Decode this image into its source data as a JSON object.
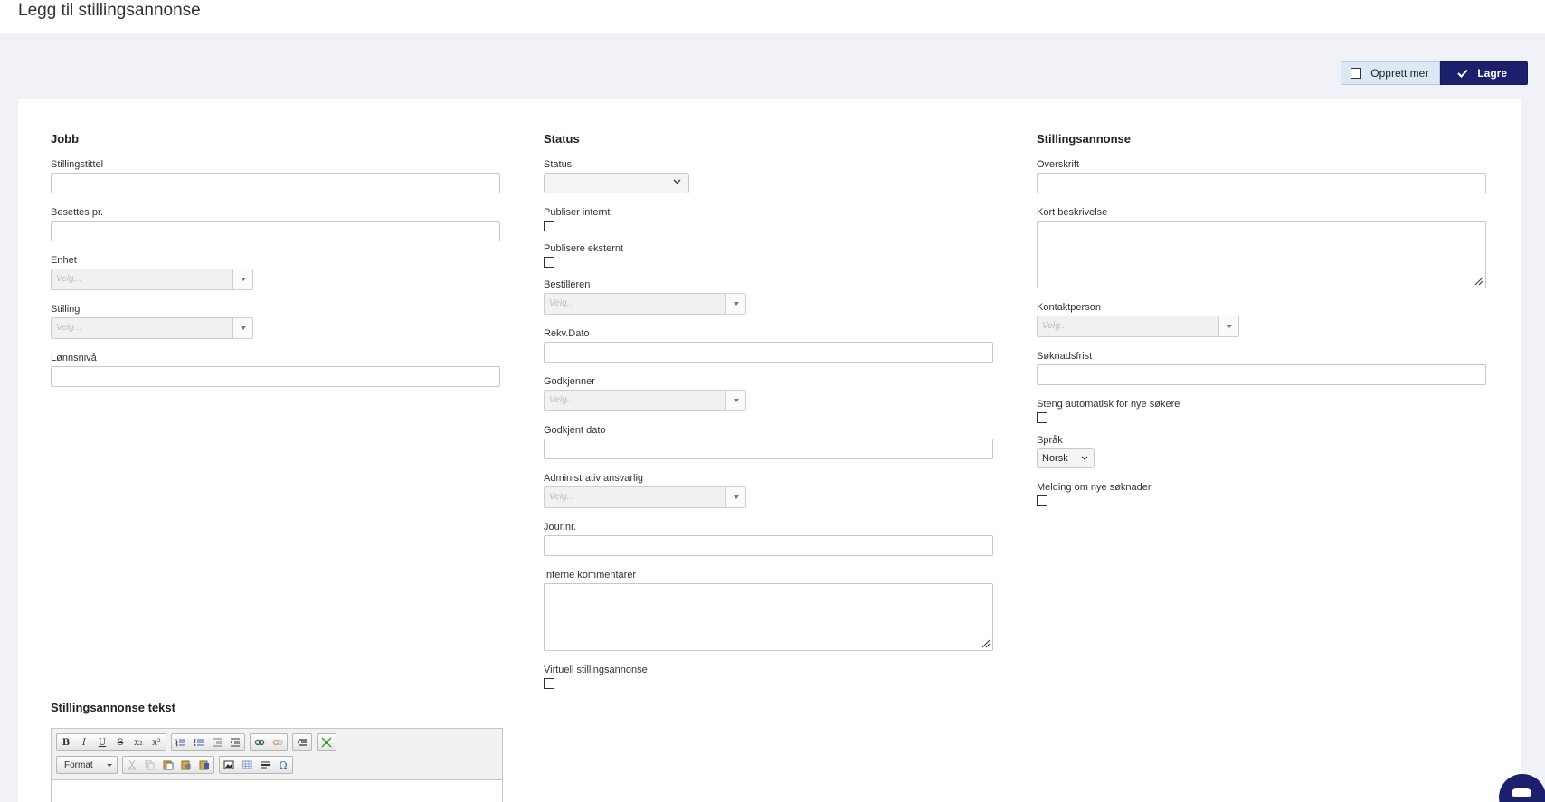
{
  "header": {
    "title": "Legg til stillingsannonse"
  },
  "actions": {
    "create_more_label": "Opprett mer",
    "save_label": "Lagre"
  },
  "jobb": {
    "heading": "Jobb",
    "stillingstittel_label": "Stillingstittel",
    "besettes_label": "Besettes pr.",
    "enhet_label": "Enhet",
    "enhet_placeholder": "Velg...",
    "stilling_label": "Stilling",
    "stilling_placeholder": "Velg...",
    "lonnsniva_label": "Lønnsnivå"
  },
  "status": {
    "heading": "Status",
    "status_label": "Status",
    "publiser_internt_label": "Publiser internt",
    "publisere_eksternt_label": "Publisere eksternt",
    "bestilleren_label": "Bestilleren",
    "bestilleren_placeholder": "Velg...",
    "rekv_dato_label": "Rekv.Dato",
    "godkjenner_label": "Godkjenner",
    "godkjenner_placeholder": "Velg...",
    "godkjent_dato_label": "Godkjent dato",
    "admin_label": "Administrativ ansvarlig",
    "admin_placeholder": "Velg...",
    "journr_label": "Jour.nr.",
    "interne_kommentarer_label": "Interne kommentarer",
    "virtuell_label": "Virtuell stillingsannonse"
  },
  "annonse": {
    "heading": "Stillingsannonse",
    "overskrift_label": "Overskrift",
    "kort_beskrivelse_label": "Kort beskrivelse",
    "kontaktperson_label": "Kontaktperson",
    "kontaktperson_placeholder": "Velg...",
    "soknadsfrist_label": "Søknadsfrist",
    "steng_label": "Steng automatisk for nye søkere",
    "sprak_label": "Språk",
    "sprak_value": "Norsk",
    "melding_label": "Melding om nye søknader"
  },
  "tekst": {
    "heading": "Stillingsannonse tekst",
    "format_label": "Format",
    "toolbar_icons": [
      "bold-icon",
      "italic-icon",
      "underline-icon",
      "strikethrough-icon",
      "subscript-icon",
      "superscript-icon",
      "numbered-list-icon",
      "bulleted-list-icon",
      "outdent-icon",
      "indent-icon",
      "link-icon",
      "unlink-icon",
      "anchor-icon",
      "maximize-icon",
      "cut-icon",
      "copy-icon",
      "paste-icon",
      "paste-text-icon",
      "paste-word-icon",
      "image-icon",
      "table-icon",
      "horizontal-rule-icon",
      "special-char-icon"
    ]
  },
  "colors": {
    "accent": "#1c1f6b",
    "background": "#f0f2f7",
    "create_more_bg": "#dde8f6"
  },
  "chat": {
    "icon": "chat-icon"
  }
}
